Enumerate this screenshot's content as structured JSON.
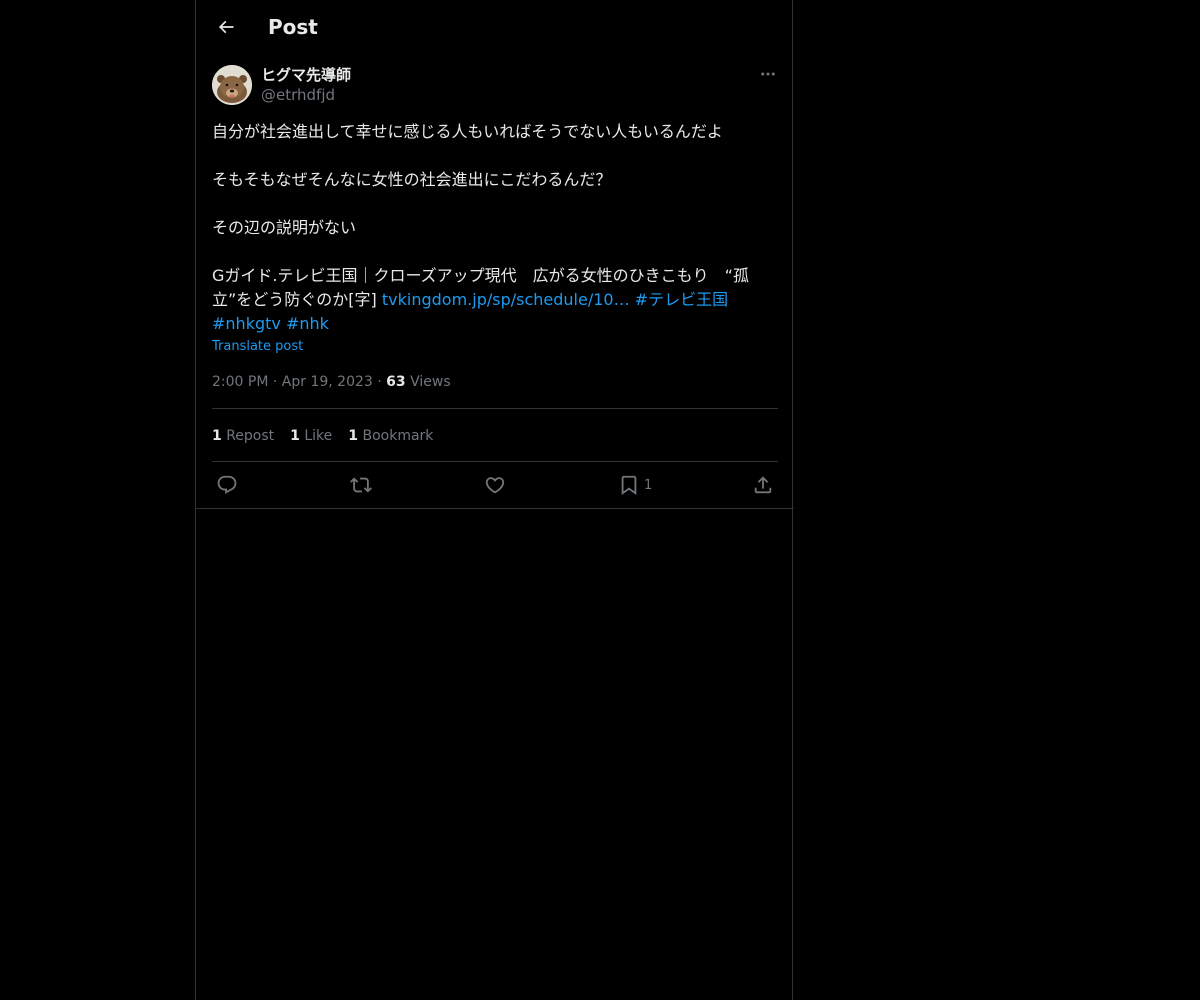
{
  "header": {
    "back_icon": "arrow-left-icon",
    "title": "Post"
  },
  "post": {
    "author": {
      "display_name": "ヒグマ先導師",
      "handle": "@etrhdfjd",
      "avatar_icon": "bear-avatar"
    },
    "more_icon": "more-horizontal-icon",
    "text": {
      "line1": "自分が社会進出して幸せに感じる人もいればそうでない人もいるんだよ",
      "line2": "そもそもなぜそんなに女性の社会進出にこだわるんだ？",
      "line3": "その辺の説明がない",
      "line4_prefix": "Gガイド.テレビ王国｜クローズアップ現代　広がる女性のひきこもり　“孤立”をどう防ぐのか[字] ",
      "link": "tvkingdom.jp/sp/schedule/10…",
      "hashtag1": "#テレビ王国",
      "hashtag2": "#nhkgtv",
      "hashtag3": "#nhk"
    },
    "translate_label": "Translate post",
    "meta": {
      "time": "2:00 PM",
      "separator": "·",
      "date": "Apr 19, 2023",
      "views_count": "63",
      "views_label": "Views"
    },
    "stats": {
      "reposts_count": "1",
      "reposts_label": "Repost",
      "likes_count": "1",
      "likes_label": "Like",
      "bookmarks_count": "1",
      "bookmarks_label": "Bookmark"
    },
    "actions": {
      "reply_icon": "reply-icon",
      "repost_icon": "repost-icon",
      "like_icon": "heart-icon",
      "bookmark_icon": "bookmark-icon",
      "bookmark_count": "1",
      "share_icon": "share-icon"
    }
  },
  "colors": {
    "background": "#000000",
    "text_primary": "#e7e9ea",
    "text_secondary": "#71767b",
    "accent": "#1d9bf0",
    "border": "#2f3336"
  }
}
